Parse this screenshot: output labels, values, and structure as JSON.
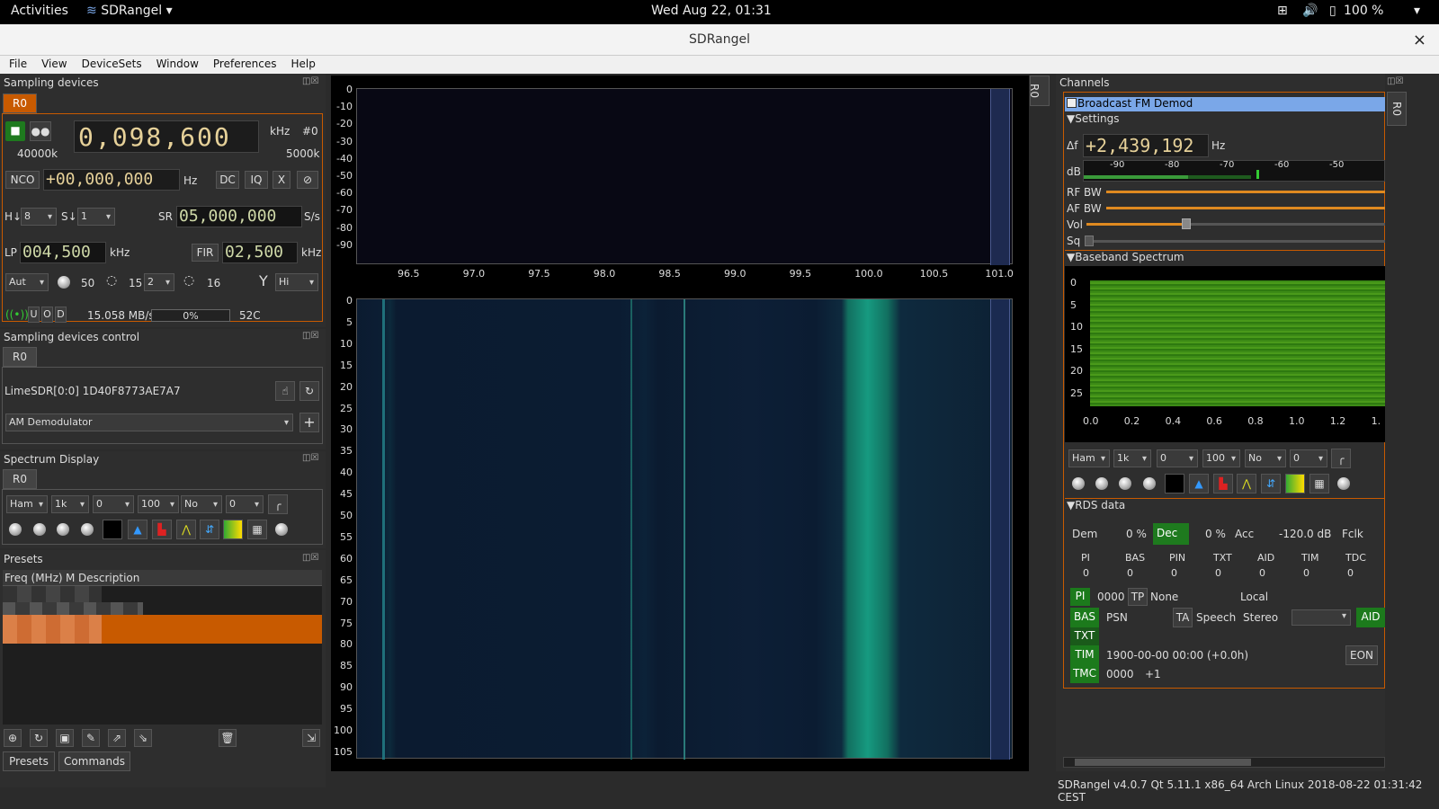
{
  "topbar": {
    "activities": "Activities",
    "app": "SDRangel",
    "datetime": "Wed Aug 22, 01:31",
    "battery": "100 %"
  },
  "window": {
    "title": "SDRangel",
    "close": "×"
  },
  "menu": [
    "File",
    "View",
    "DeviceSets",
    "Window",
    "Preferences",
    "Help"
  ],
  "sampling_devices": {
    "title": "Sampling devices",
    "tab": "R0",
    "freq_digits": "0,098,600",
    "freq_unit": "kHz",
    "dev_index": "#0",
    "sr_left": "40000k",
    "sr_right": "5000k",
    "nco_label": "NCO",
    "nco_value": "+00,000,000",
    "nco_unit": "Hz",
    "dc": "DC",
    "iq": "IQ",
    "x": "X",
    "h_label": "H↓",
    "h_value": "8",
    "s_label": "S↓",
    "s_value": "1",
    "sr_label": "SR",
    "sr_value": "05,000,000",
    "sr_unit": "S/s",
    "lp_label": "LP",
    "lp_value": "004,500",
    "lp_unit": "kHz",
    "fir": "FIR",
    "fir_value": "02,500",
    "fir_unit": "kHz",
    "gain_mode": "Aut",
    "gain1": "50",
    "gain2": "15",
    "gain3_sel": "2",
    "gain4": "16",
    "antenna": "Hi",
    "u": "U",
    "o": "O",
    "d": "D",
    "rate": "15.058 MB/s",
    "progress": "0%",
    "temp": "52C"
  },
  "sampling_control": {
    "title": "Sampling devices control",
    "tab": "R0",
    "device": "LimeSDR[0:0] 1D40F8773AE7A7",
    "channel_select": "AM Demodulator"
  },
  "spectrum_display": {
    "title": "Spectrum Display",
    "tab": "R0",
    "window": "Ham",
    "fft": "1k",
    "ref": "0",
    "range": "100",
    "avg_mode": "No",
    "avg": "0"
  },
  "presets": {
    "title": "Presets",
    "col_freq": "Freq (MHz)",
    "col_m": "M",
    "col_desc": "Description",
    "tab_presets": "Presets",
    "tab_commands": "Commands"
  },
  "spectrum": {
    "side_tab": "R0",
    "y_ticks": [
      "0",
      "-10",
      "-20",
      "-30",
      "-40",
      "-50",
      "-60",
      "-70",
      "-80",
      "-90"
    ],
    "x_ticks": [
      "96.5",
      "97.0",
      "97.5",
      "98.0",
      "98.5",
      "99.0",
      "99.5",
      "100.0",
      "100.5",
      "101.0"
    ],
    "wf_ticks": [
      "0",
      "5",
      "10",
      "15",
      "20",
      "25",
      "30",
      "35",
      "40",
      "45",
      "50",
      "55",
      "60",
      "65",
      "70",
      "75",
      "80",
      "85",
      "90",
      "95",
      "100",
      "105"
    ]
  },
  "channels": {
    "title": "Channels",
    "side_tab": "R0",
    "channel": "Broadcast FM Demod",
    "settings": "Settings",
    "df_label": "Δf",
    "df_value": "+2,439,192",
    "df_unit": "Hz",
    "db_label": "dB",
    "db_ticks": [
      "-90",
      "-80",
      "-70",
      "-60",
      "-50"
    ],
    "rfbw": "RF BW",
    "afbw": "AF BW",
    "vol": "Vol",
    "sq": "Sq",
    "baseband": "Baseband Spectrum",
    "bb_y": [
      "0",
      "5",
      "10",
      "15",
      "20",
      "25"
    ],
    "bb_x": [
      "0.0",
      "0.2",
      "0.4",
      "0.6",
      "0.8",
      "1.0",
      "1.2",
      "1."
    ],
    "bb_window": "Ham",
    "bb_fft": "1k",
    "bb_ref": "0",
    "bb_range": "100",
    "bb_avg_mode": "No",
    "bb_avg": "0",
    "rds": {
      "title": "RDS data",
      "dem": "Dem",
      "dem_val": "0 %",
      "dec": "Dec",
      "dec_val": "0 %",
      "acc": "Acc",
      "acc_val": "-120.0 dB",
      "fclk": "Fclk",
      "cols": [
        "PI",
        "BAS",
        "PIN",
        "TXT",
        "AID",
        "TIM",
        "TDC"
      ],
      "vals": [
        "0",
        "0",
        "0",
        "0",
        "0",
        "0",
        "0"
      ],
      "pi": "PI",
      "pi_val": "0000",
      "tp": "TP",
      "tp_val": "None",
      "local": "Local",
      "bas": "BAS",
      "psn": "PSN",
      "ta": "TA",
      "speech": "Speech",
      "stereo": "Stereo",
      "aid": "AID",
      "txt": "TXT",
      "tim": "TIM",
      "tim_val": "1900-00-00 00:00 (+0.0h)",
      "eon": "EON",
      "tmc": "TMC",
      "tmc_val": "0000",
      "tmc_extra": "+1"
    }
  },
  "status": "SDRangel v4.0.7 Qt 5.11.1 x86_64 Arch Linux  2018-08-22 01:31:42 CEST",
  "colors": {
    "accent": "#c85a00",
    "green": "#1e7a1e",
    "selection": "#7aa7e8"
  }
}
